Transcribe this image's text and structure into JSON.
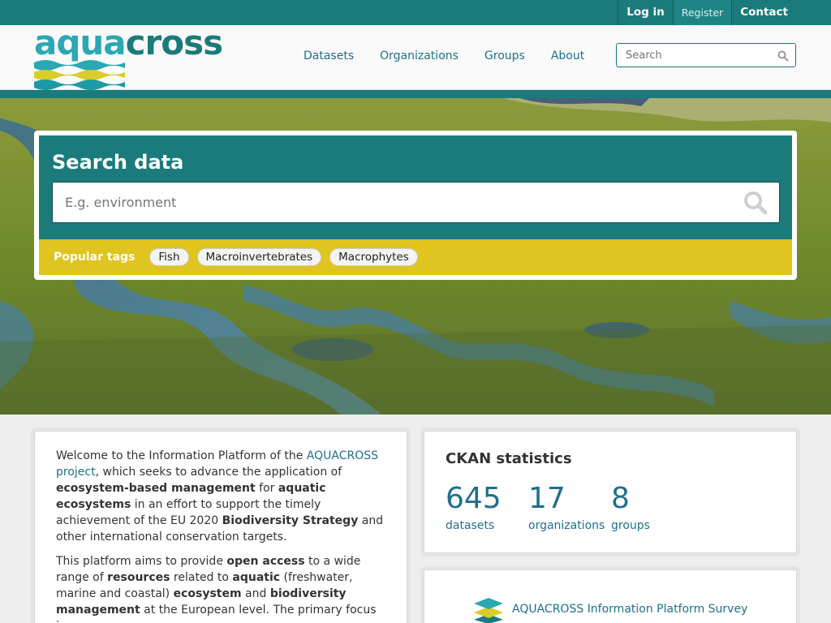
{
  "account": {
    "login": "Log in",
    "register": "Register",
    "contact": "Contact"
  },
  "brand": {
    "part1": "aqua",
    "part2": "cross",
    "colors": {
      "light": "#2aa8b3",
      "dark": "#1b7a7b",
      "yellow": "#d8cd2a"
    }
  },
  "nav": {
    "items": [
      {
        "label": "Datasets"
      },
      {
        "label": "Organizations"
      },
      {
        "label": "Groups"
      },
      {
        "label": "About"
      }
    ]
  },
  "site_search": {
    "placeholder": "Search",
    "icon": "search-icon"
  },
  "hero_search": {
    "title": "Search data",
    "placeholder": "E.g. environment",
    "popular_label": "Popular tags",
    "tags": [
      "Fish",
      "Macroinvertebrates",
      "Macrophytes"
    ]
  },
  "intro": {
    "p1": {
      "t1": "Welcome to the Information Platform of the ",
      "link": "AQUACROSS project",
      "t2": ", which seeks to advance the application of ",
      "b1": "ecosystem-based management",
      "t3": " for ",
      "b2": "aquatic ecosystems",
      "t4": " in an effort to support the timely achievement of the EU 2020 ",
      "b3": "Biodiversity Strategy",
      "t5": " and other international conservation targets."
    },
    "p2": {
      "t1": "This platform aims to provide ",
      "b1": "open access",
      "t2": " to a wide range of ",
      "b2": "resources",
      "t3": " related to ",
      "b3": "aquatic",
      "t4": " (freshwater, marine and coastal) ",
      "b4": "ecosystem",
      "t5": " and ",
      "b5": "biodiversity management",
      "t6": " at the European level. The primary focus is"
    }
  },
  "stats": {
    "title": "CKAN statistics",
    "items": [
      {
        "value": "645",
        "label": "datasets"
      },
      {
        "value": "17",
        "label": "organizations"
      },
      {
        "value": "8",
        "label": "groups"
      }
    ]
  },
  "survey": {
    "label": "AQUACROSS Information Platform Survey",
    "icon": "layers-icon"
  },
  "colors": {
    "teal": "#1b7a7b",
    "tag_bar": "#e0c41f",
    "link": "#1f6f8b"
  }
}
